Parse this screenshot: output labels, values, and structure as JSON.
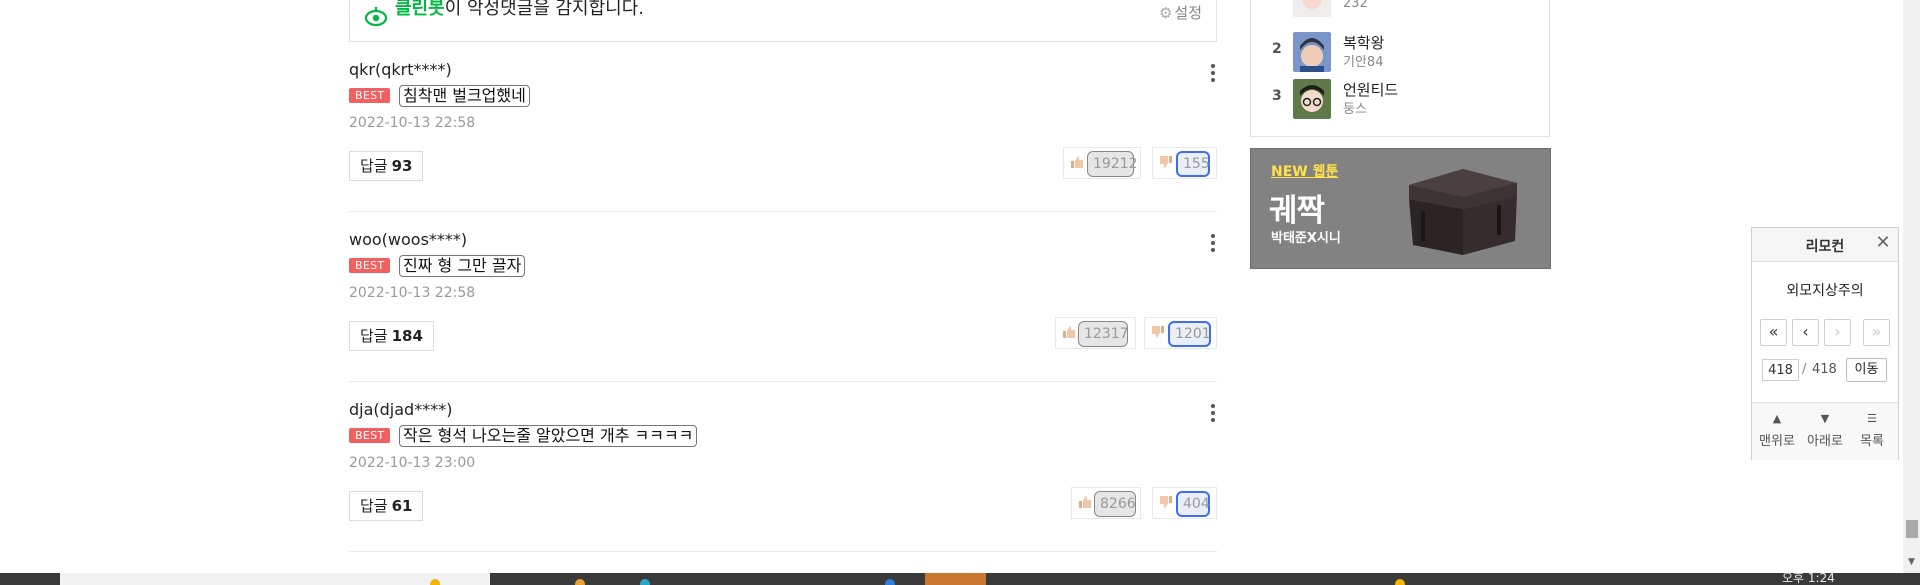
{
  "cleanbot": {
    "brand": "클린봇",
    "message": "이 악성댓글을 감지합니다.",
    "settings_label": "설정"
  },
  "comments": [
    {
      "author": "qkr(qkrt****)",
      "badge": "BEST",
      "text": "침착맨 벌크업했네",
      "date": "2022-10-13 22:58",
      "reply_label": "답글",
      "reply_count": "93",
      "likes": "19212",
      "dislikes": "155"
    },
    {
      "author": "woo(woos****)",
      "badge": "BEST",
      "text": "진짜 형 그만 끌자",
      "date": "2022-10-13 22:58",
      "reply_label": "답글",
      "reply_count": "184",
      "likes": "12317",
      "dislikes": "1201"
    },
    {
      "author": "dja(djad****)",
      "badge": "BEST",
      "text": "작은 형석 나오는줄 알았으면 개추 ㅋㅋㅋㅋ",
      "date": "2022-10-13 23:00",
      "reply_label": "답글",
      "reply_count": "61",
      "likes": "8266",
      "dislikes": "404"
    }
  ],
  "ranking": {
    "items": [
      {
        "rank": "",
        "title": "",
        "sub": "232"
      },
      {
        "rank": "2",
        "title": "복학왕",
        "sub": "기안84"
      },
      {
        "rank": "3",
        "title": "언원티드",
        "sub": "둥스"
      }
    ]
  },
  "ad": {
    "tag": "NEW 웹툰",
    "title": "궤짝",
    "authors": "박태준X시니"
  },
  "remote": {
    "title": "리모컨",
    "webtoon": "외모지상주의",
    "page_value": "418",
    "total": "418",
    "go_label": "이동",
    "to_top_label": "맨위로",
    "to_bottom_label": "아래로",
    "list_label": "목록"
  },
  "taskbar": {
    "clock": "오후 1:24"
  },
  "icons": {
    "cleanbot": "eye-icon",
    "settings": "gear-icon",
    "more": "kebab-menu-icon",
    "like": "thumbs-up-icon",
    "dislike": "thumbs-down-icon",
    "close": "close-icon",
    "first": "double-chevron-left-icon",
    "prev": "chevron-left-icon",
    "next": "chevron-right-icon",
    "last": "double-chevron-right-icon",
    "top": "triangle-up-icon",
    "bottom": "triangle-down-icon",
    "list": "list-icon"
  },
  "colors": {
    "cleanbot_green": "#00b843",
    "best_badge": "#f15f5f",
    "dislike_highlight": "#3f6df0",
    "ad_tag": "#ffe14b"
  }
}
